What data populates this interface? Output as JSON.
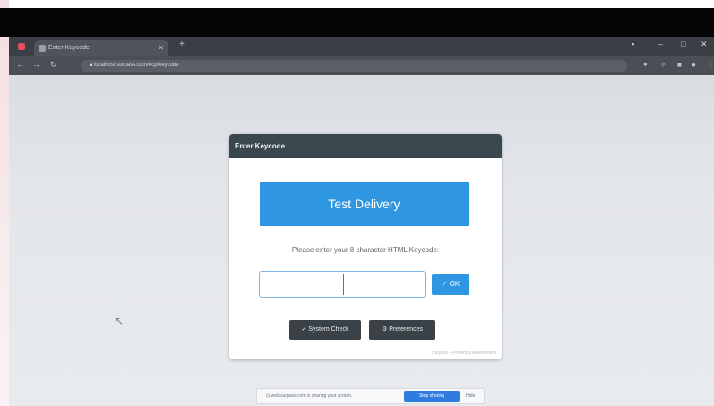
{
  "browser": {
    "tab_title": "Enter Keycode",
    "url": "localhost.surpass.com/ecp/keycode"
  },
  "dialog": {
    "title": "Enter Keycode",
    "delivery_button": "Test Delivery",
    "prompt": "Please enter your 8 character HTML Keycode:",
    "keycode_part1": "",
    "keycode_part2": "",
    "ok_label": "OK",
    "system_check_label": "System Check",
    "preferences_label": "Preferences",
    "footer_note": "Surpass - Powering Assessment"
  },
  "sharing_bar": {
    "message": "web.surpass.com is sharing your screen.",
    "stop_label": "Stop sharing",
    "hide_label": "Hide"
  },
  "colors": {
    "accent": "#2f97e1",
    "header": "#3a474f",
    "dark_button": "#3a4248"
  },
  "icons": [
    "record-icon",
    "tab-favicon-icon",
    "close-icon",
    "plus-icon",
    "minimize-icon",
    "maximize-icon",
    "window-close-icon",
    "back-icon",
    "forward-icon",
    "reload-icon",
    "lock-icon",
    "extension-icon",
    "profile-icon",
    "menu-icon",
    "cursor-icon",
    "check-icon",
    "gear-icon",
    "share-icon"
  ]
}
